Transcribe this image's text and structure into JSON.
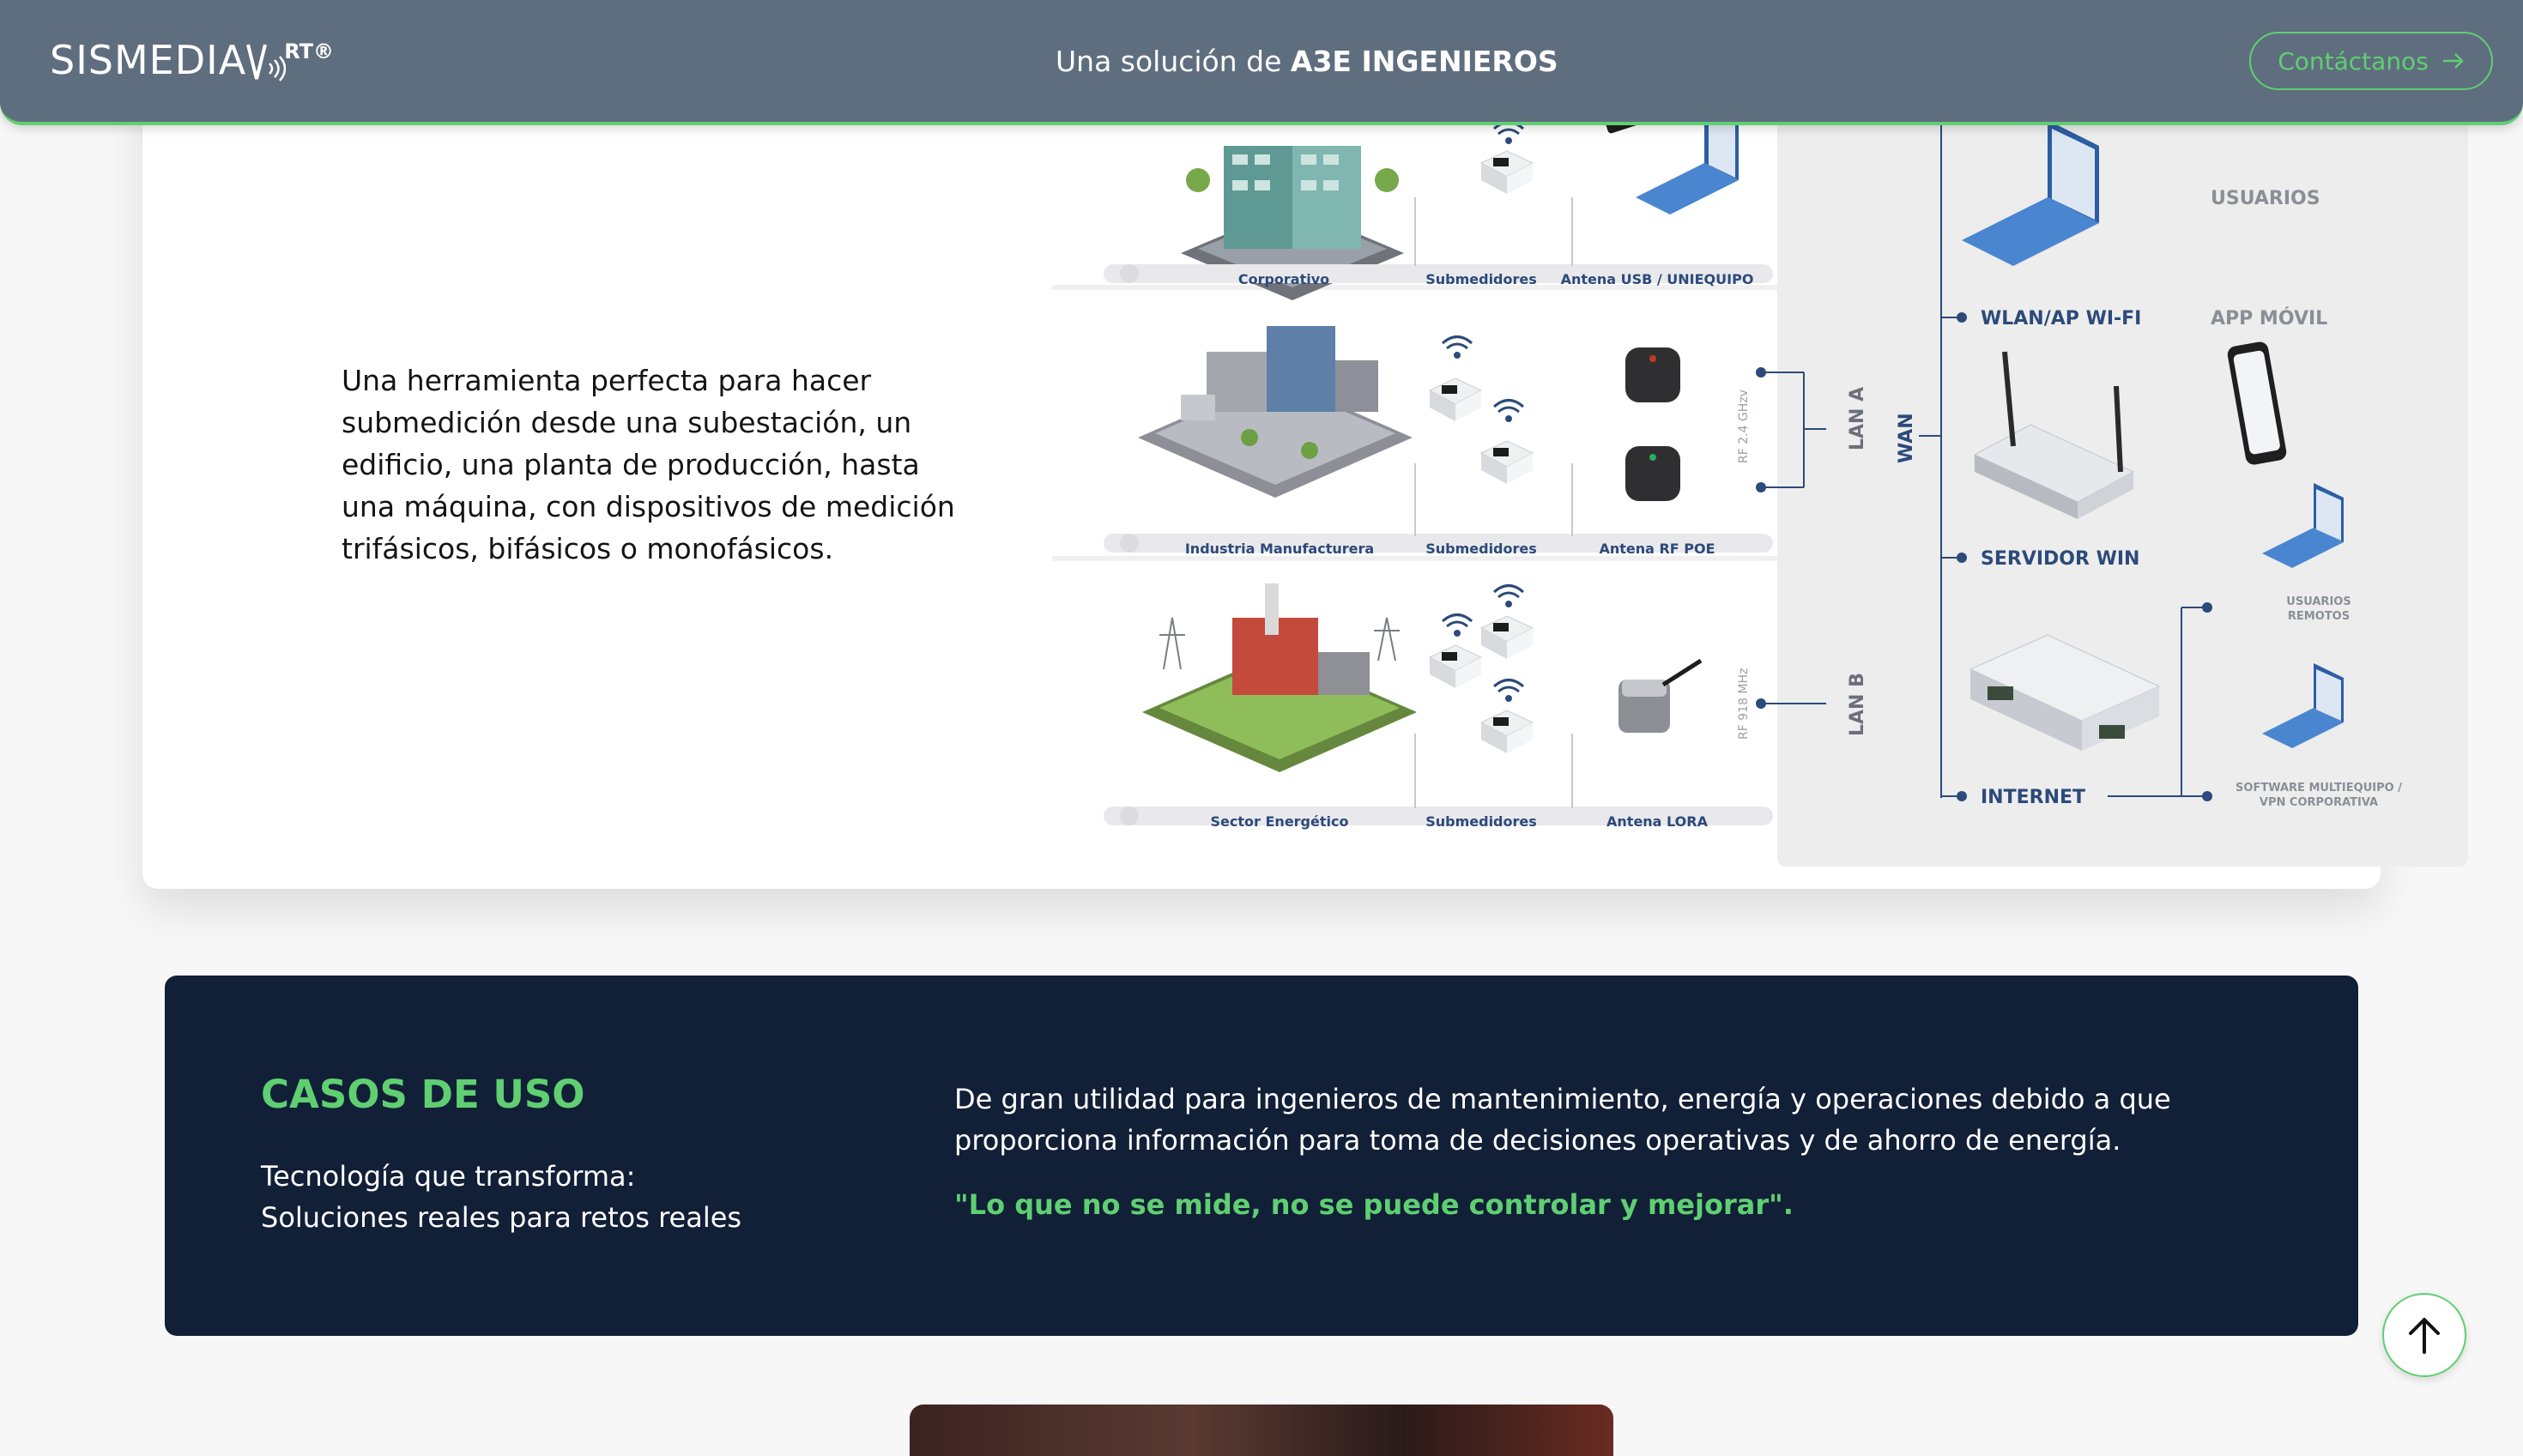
{
  "header": {
    "logo_text": "SISMEDIA",
    "logo_suffix": "RT®",
    "tagline_prefix": "Una solución de ",
    "tagline_brand": "A3E INGENIEROS",
    "contact_label": "Contáctanos",
    "contact_icon": "arrow-right-icon"
  },
  "card": {
    "description": "Una herramienta perfecta para hacer submedición desde una subestación, un edificio, una planta de producción, hasta una máquina, con dispositivos de medición trifásicos, bifásicos o monofásicos."
  },
  "diagram": {
    "rows": [
      {
        "site": "Corporativo",
        "meters": "Submedidores",
        "antenna": "Antena USB / UNIEQUIPO"
      },
      {
        "site": "Industria Manufacturera",
        "meters": "Submedidores",
        "antenna": "Antena RF POE"
      },
      {
        "site": "Sector Energético",
        "meters": "Submedidores",
        "antenna": "Antena LORA"
      }
    ],
    "rf_24": "RF 2.4 GHzv",
    "rf_918": "RF 918 MHz",
    "lan_a": "LAN A",
    "lan_b": "LAN B",
    "wan": "WAN",
    "wlan": "WLAN/AP WI-FI",
    "servidor": "SERVIDOR WIN",
    "internet": "INTERNET",
    "usuarios": "USUARIOS",
    "app_movil": "APP MÓVIL",
    "usuarios_remotos_1": "USUARIOS",
    "usuarios_remotos_2": "REMOTOS",
    "software_1": "SOFTWARE MULTIEQUIPO /",
    "software_2": "VPN CORPORATIVA",
    "colors": {
      "label_blue": "#2c4a7a",
      "panel": "#ededed",
      "gray_label": "#8a8f96"
    }
  },
  "usecases": {
    "title": "CASOS DE USO",
    "subtitle_line1": "Tecnología que transforma:",
    "subtitle_line2": "Soluciones reales para retos reales",
    "description": "De gran utilidad para ingenieros de mantenimiento, energía y operaciones debido a que proporciona información para toma de decisiones operativas y de ahorro de energía.",
    "quote": "\"Lo que no se mide, no se puede controlar y mejorar\"."
  },
  "scroll_top": {
    "icon": "arrow-up-icon"
  },
  "colors": {
    "accent": "#5fcf72",
    "header_bg": "#5f6e7e",
    "navy": "#111f37"
  }
}
